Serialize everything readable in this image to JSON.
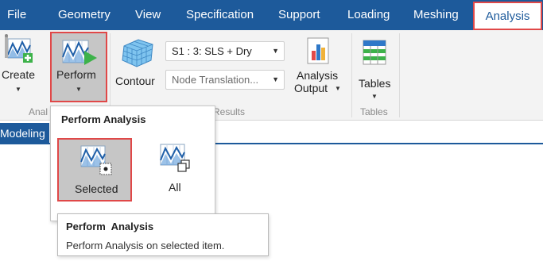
{
  "menubar": {
    "items": [
      "File",
      "Geometry",
      "View",
      "Specification",
      "Support",
      "Loading",
      "Meshing",
      "Analysis"
    ],
    "active": "Analysis"
  },
  "ribbon": {
    "create_label": "Create",
    "perform_label": "Perform",
    "analysis_group_label_partial": "Anal",
    "contour_label": "Contour",
    "loadcase_value": "S1 : 3: SLS + Dry",
    "result_type_value": "Node Translation...",
    "view_results_group_label_partial": "w Results",
    "analysis_output_label_1": "Analysis",
    "analysis_output_label_2": "Output",
    "tables_label": "Tables",
    "tables_group_label": "Tables"
  },
  "tabs": {
    "modeling": "Modeling"
  },
  "popup": {
    "title": "Perform Analysis",
    "options": [
      {
        "label": "Selected"
      },
      {
        "label": "All"
      }
    ]
  },
  "tooltip": {
    "title": "Perform  Analysis",
    "body": "Perform Analysis on selected item."
  },
  "colors": {
    "menubar": "#1d5a9b",
    "highlight_border": "#e04848",
    "pressed_bg": "#c6c6c6"
  }
}
